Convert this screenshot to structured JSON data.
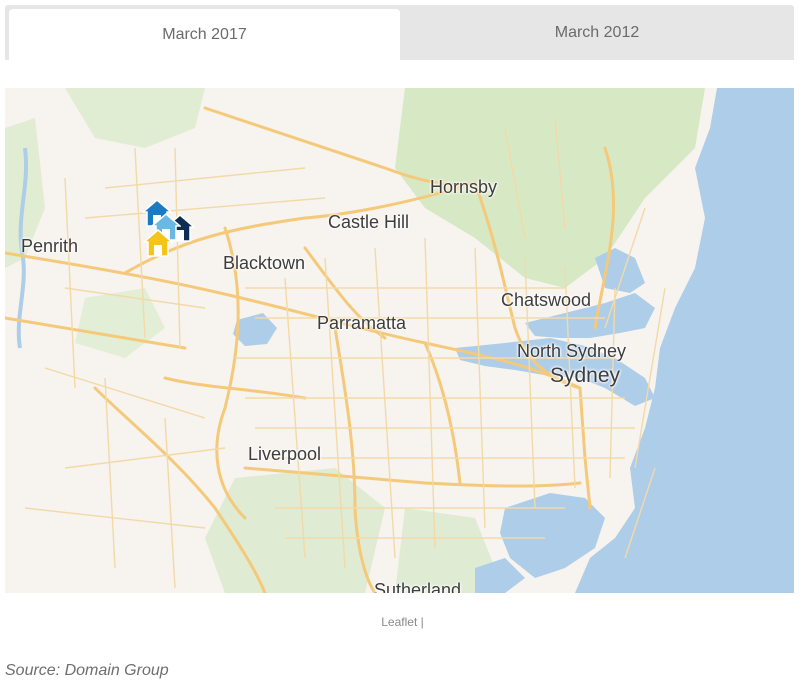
{
  "tabs": [
    {
      "label": "March 2017",
      "active": true
    },
    {
      "label": "March 2012",
      "active": false
    }
  ],
  "map": {
    "places": {
      "penrith": "Penrith",
      "blacktown": "Blacktown",
      "castle_hill": "Castle Hill",
      "hornsby": "Hornsby",
      "parramatta": "Parramatta",
      "chatswood": "Chatswood",
      "north_sydney": "North Sydney",
      "sydney": "Sydney",
      "liverpool": "Liverpool",
      "sutherland": "Sutherland"
    },
    "markers": [
      {
        "icon": "house-marker-icon",
        "color": "#1a7bc4"
      },
      {
        "icon": "house-marker-icon",
        "color": "#0f2d52"
      },
      {
        "icon": "house-marker-icon",
        "color": "#6ab8e4"
      },
      {
        "icon": "house-marker-icon",
        "color": "#f6c31a"
      }
    ],
    "colors": {
      "land": "#f7f3ee",
      "water": "#aecde9",
      "park": "#d7e8c5",
      "road": "#f5c97a"
    }
  },
  "attribution": {
    "label": "Leaflet",
    "separator": "|"
  },
  "source": "Source: Domain Group"
}
